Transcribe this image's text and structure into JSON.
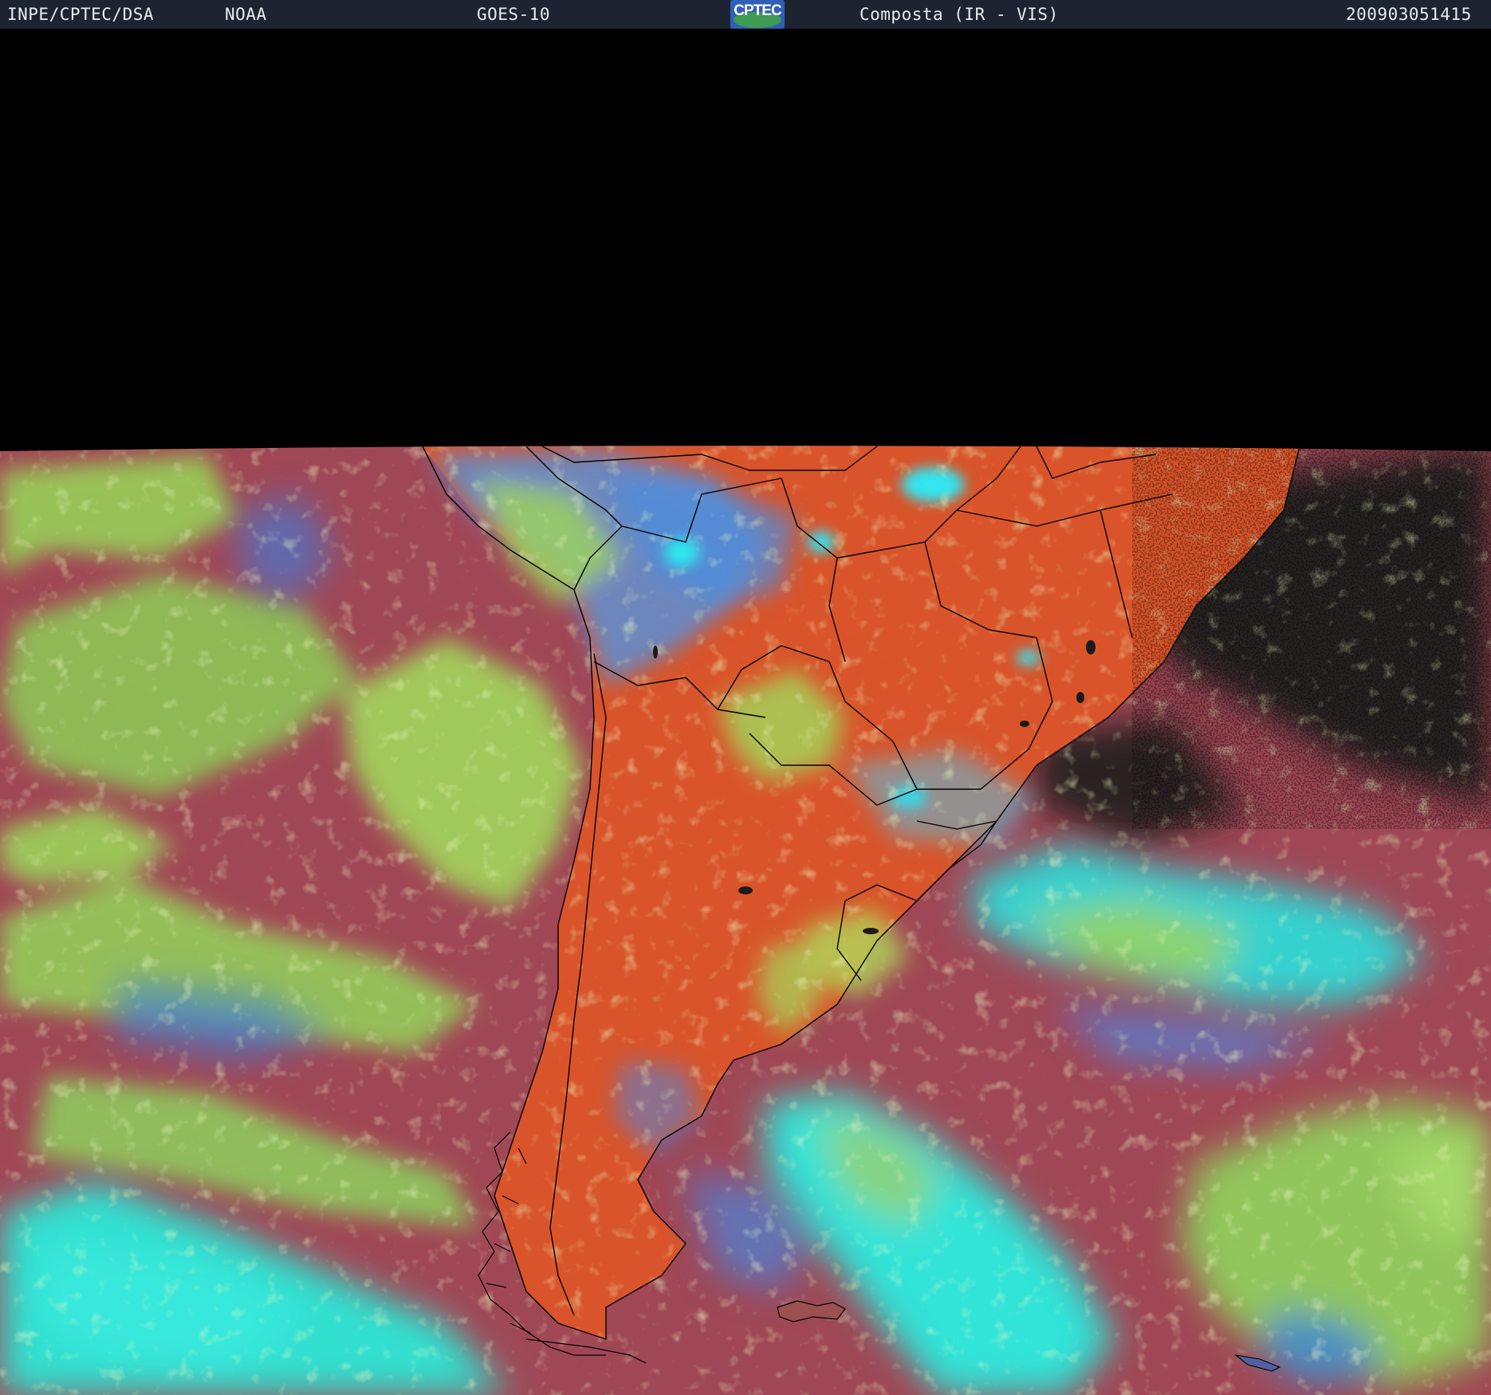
{
  "header": {
    "agency": "INPE/CPTEC/DSA",
    "source": "NOAA",
    "satellite": "GOES-10",
    "logo_text": "CPTEC",
    "product": "Composta (IR - VIS)",
    "timestamp": "200903051415"
  },
  "colors": {
    "header_bg": "#1b2430",
    "ocean_clear": "#a04755",
    "land_clear": "#d9542a",
    "low_cloud": "#9ad25a",
    "high_cloud": "#2ee6ee",
    "mid_cloud": "#4f86e0",
    "clear_dark": "#1e1e1e",
    "outline": "#000000"
  }
}
